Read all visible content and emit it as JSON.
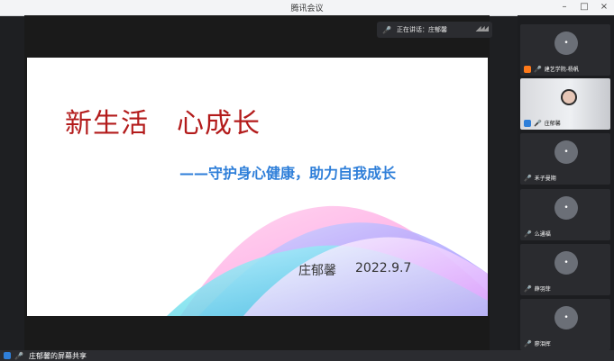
{
  "window": {
    "title": "腾讯会议"
  },
  "speaker_bar": {
    "label": "正在讲话：庄郁馨"
  },
  "slide": {
    "title": "新生活　心成长",
    "subtitle": "——守护身心健康，助力自我成长",
    "author": "庄郁馨",
    "date": "2022.9.7"
  },
  "participants": [
    {
      "name": "建艺学院-杨帆"
    },
    {
      "name": "庄郁馨"
    },
    {
      "name": "禾子曼期"
    },
    {
      "name": "么通福"
    },
    {
      "name": "薛羽菲"
    },
    {
      "name": "廖泪挥"
    }
  ],
  "bottom_bar": {
    "status": "庄郁馨的屏幕共享"
  },
  "colors": {
    "accent": "#2f7fd9",
    "title_red": "#b31b1b"
  }
}
